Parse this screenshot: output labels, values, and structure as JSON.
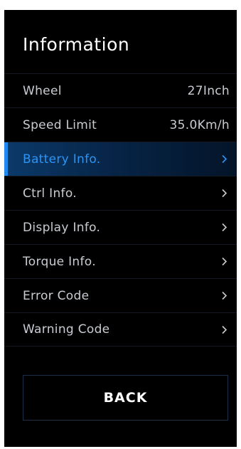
{
  "page": {
    "title": "Information",
    "back_label": "BACK"
  },
  "menu": {
    "items": [
      {
        "label": "Wheel",
        "value": "27Inch"
      },
      {
        "label": "Speed Limit",
        "value": "35.0Km/h"
      },
      {
        "label": "Battery Info.",
        "icon": "chevron-right-icon",
        "selected": true
      },
      {
        "label": "Ctrl Info.",
        "icon": "chevron-right-icon"
      },
      {
        "label": "Display Info.",
        "icon": "chevron-right-icon"
      },
      {
        "label": "Torque Info.",
        "icon": "chevron-right-icon"
      },
      {
        "label": "Error Code",
        "icon": "chevron-right-icon"
      },
      {
        "label": "Warning Code",
        "icon": "chevron-right-icon"
      }
    ]
  },
  "colors": {
    "background": "#000000",
    "text": "#c9cdd3",
    "accent": "#1f8bf0",
    "selected_text": "#2b95f5"
  }
}
